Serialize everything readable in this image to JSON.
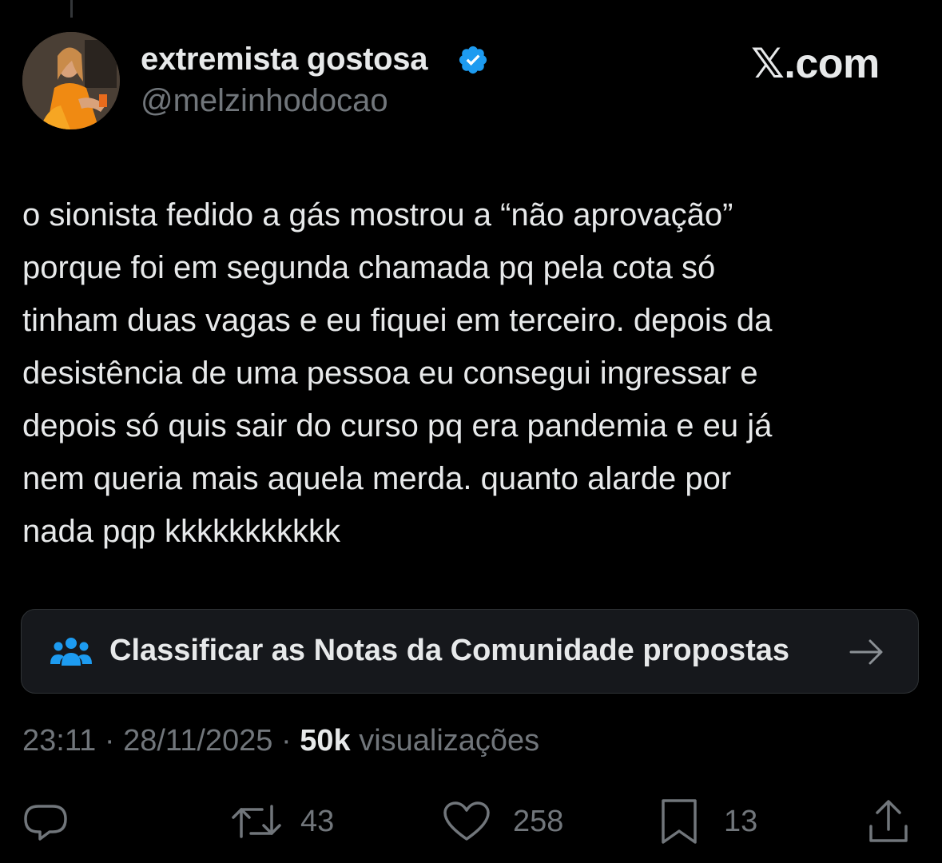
{
  "post": {
    "author": {
      "display_name": "extremista gostosa",
      "handle": "@melzinhodocao",
      "verified": true
    },
    "brand": "𝕏.com",
    "text": "o sionista fedido a gás mostrou a “não aprovação”\nporque foi em segunda chamada pq pela cota só\ntinham duas vagas e eu fiquei em terceiro. depois da\ndesistência de uma pessoa eu consegui ingressar e\ndepois só quis sair do curso pq era pandemia e eu já\nnem queria mais aquela merda. quanto alarde por\nnada pqp kkkkkkkkkkk",
    "community_notes": {
      "label": "Classificar as Notas da Comunidade propostas",
      "icon": "people-icon"
    },
    "time": "23:11",
    "separator": "·",
    "date": "28/11/2025",
    "views_count": "50k",
    "views_label": "visualizações",
    "actions": {
      "reply": {
        "icon": "reply-icon",
        "count": ""
      },
      "repost": {
        "icon": "repost-icon",
        "count": "43"
      },
      "like": {
        "icon": "heart-icon",
        "count": "258"
      },
      "bookmark": {
        "icon": "bookmark-icon",
        "count": "13"
      },
      "share": {
        "icon": "share-icon",
        "count": ""
      }
    }
  },
  "colors": {
    "background": "#000000",
    "text_primary": "#e7e9ea",
    "text_secondary": "#71767b",
    "verified_blue": "#1d9bf0",
    "card_border": "#2f3336",
    "card_bg": "#16181c"
  }
}
